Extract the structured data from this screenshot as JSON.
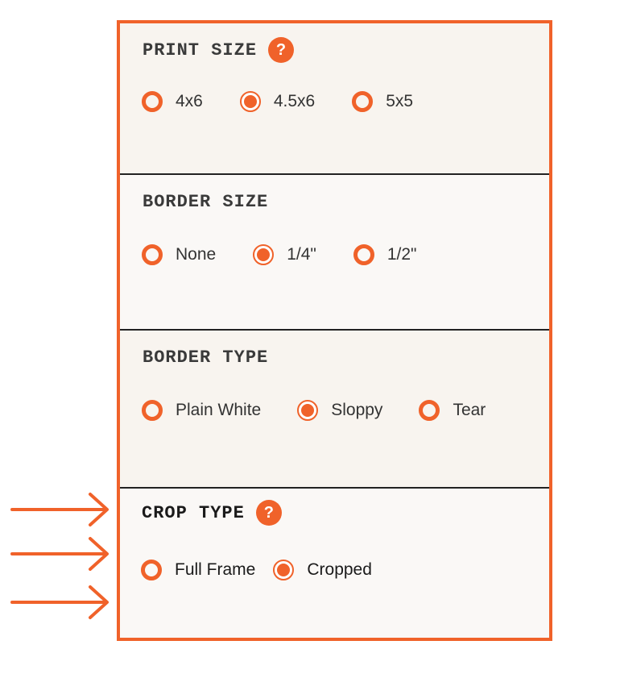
{
  "accent_color": "#f0622a",
  "sections": [
    {
      "title": "PRINT SIZE",
      "has_help": true,
      "help_icon": "?",
      "options": [
        {
          "label": "4x6",
          "selected": false
        },
        {
          "label": "4.5x6",
          "selected": true
        },
        {
          "label": "5x5",
          "selected": false
        }
      ]
    },
    {
      "title": "BORDER SIZE",
      "has_help": false,
      "options": [
        {
          "label": "None",
          "selected": false
        },
        {
          "label": "1/4\"",
          "selected": true
        },
        {
          "label": "1/2\"",
          "selected": false
        }
      ]
    },
    {
      "title": "BORDER TYPE",
      "has_help": false,
      "options": [
        {
          "label": "Plain White",
          "selected": false
        },
        {
          "label": "Sloppy",
          "selected": true
        },
        {
          "label": "Tear",
          "selected": false
        }
      ]
    },
    {
      "title": "CROP TYPE",
      "has_help": true,
      "help_icon": "?",
      "options": [
        {
          "label": "Full Frame",
          "selected": false
        },
        {
          "label": "Cropped",
          "selected": true
        }
      ]
    }
  ],
  "annotations": {
    "arrow_count": 3,
    "arrow_icon": "arrow-right-icon"
  }
}
